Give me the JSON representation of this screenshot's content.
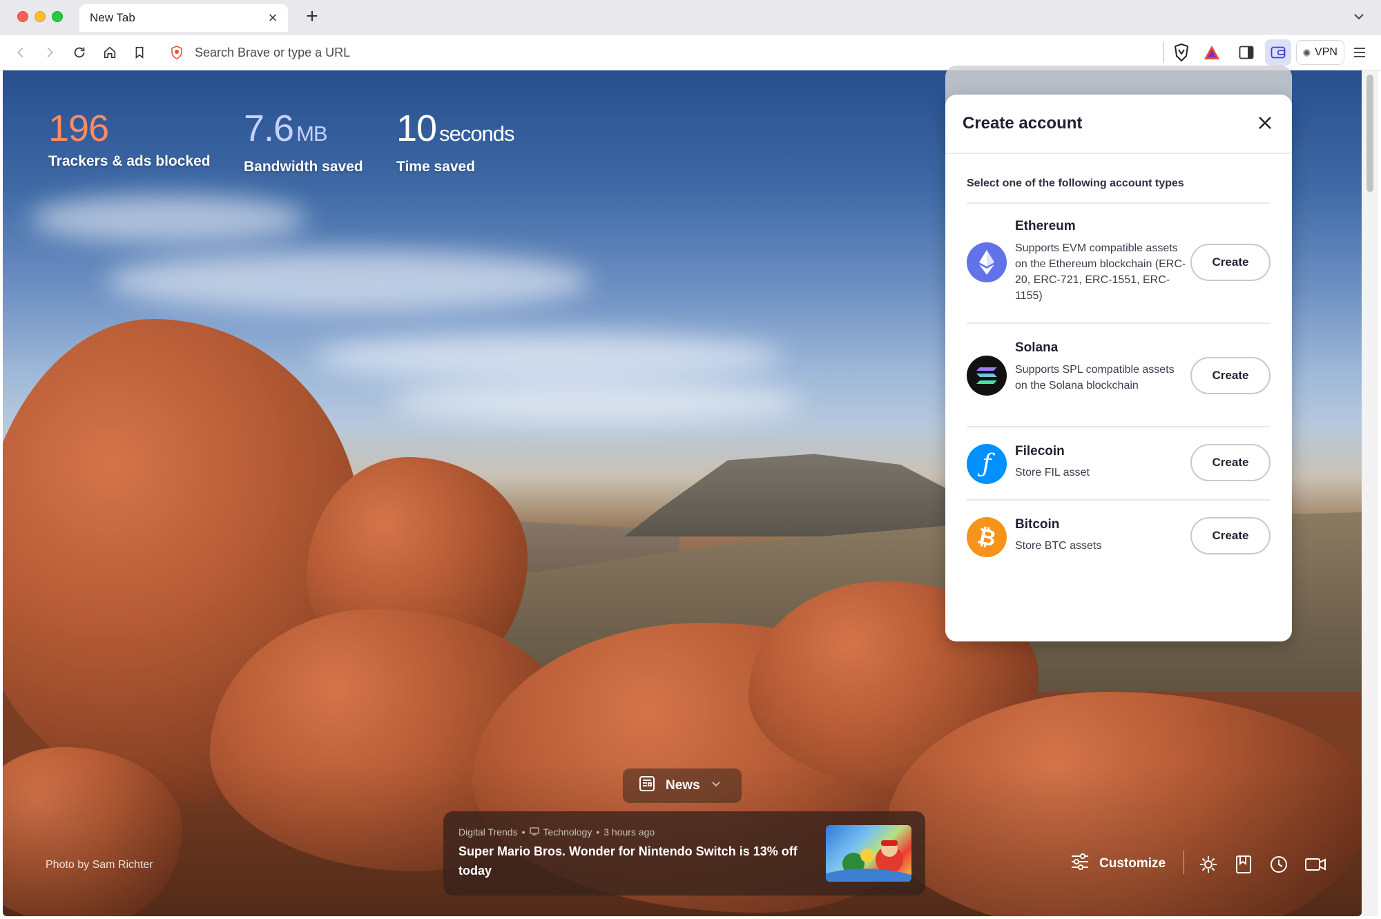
{
  "browser": {
    "tab_title": "New Tab",
    "tab_close_glyph": "×",
    "new_tab_glyph": "+",
    "search_placeholder": "Search Brave or type a URL",
    "vpn_label": "VPN"
  },
  "stats": {
    "trackers_value": "196",
    "trackers_label": "Trackers & ads blocked",
    "bandwidth_value": "7.6",
    "bandwidth_unit": "MB",
    "bandwidth_label": "Bandwidth saved",
    "time_value": "10",
    "time_unit": "seconds",
    "time_label": "Time saved"
  },
  "photo_credit": "Photo by Sam Richter",
  "news": {
    "toggle_label": "News",
    "source": "Digital Trends",
    "bullet": "•",
    "category": "Technology",
    "age": "3 hours ago",
    "headline": "Super Mario Bros. Wonder for Nintendo Switch is 13% off today"
  },
  "customize_label": "Customize",
  "wallet_panel": {
    "title": "Create account",
    "subtitle": "Select one of the following account types",
    "create_label": "Create",
    "accounts": [
      {
        "name": "Ethereum",
        "description": "Supports EVM compatible assets on the Ethereum blockchain (ERC-20, ERC-721, ERC-1551, ERC-1155)",
        "icon": "ethereum-icon",
        "color": "#6272e8"
      },
      {
        "name": "Solana",
        "description": "Supports SPL compatible assets on the Solana blockchain",
        "icon": "solana-icon",
        "color": "#111111"
      },
      {
        "name": "Filecoin",
        "description": "Store FIL asset",
        "icon": "filecoin-icon",
        "color": "#0090ff"
      },
      {
        "name": "Bitcoin",
        "description": "Store BTC assets",
        "icon": "bitcoin-icon",
        "color": "#f7931a"
      }
    ]
  }
}
